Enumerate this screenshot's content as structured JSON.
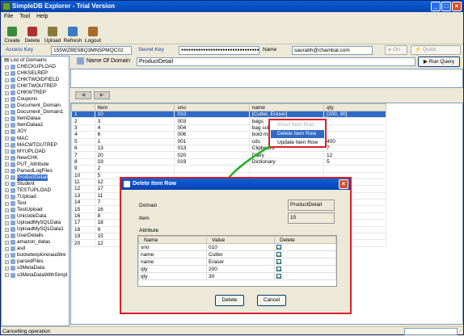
{
  "window": {
    "title": "SimpleDB Explorer - Trial Version"
  },
  "menu": [
    "File",
    "Tool",
    "Help"
  ],
  "toolbar": [
    {
      "label": "Create",
      "icon": "create-icon",
      "color": "#3a8a3a"
    },
    {
      "label": "Delete",
      "icon": "delete-icon",
      "color": "#b03030"
    },
    {
      "label": "Upload",
      "icon": "upload-icon",
      "color": "#8a7a3a"
    },
    {
      "label": "Refresh",
      "icon": "refresh-icon",
      "color": "#3a7ac0"
    },
    {
      "label": "Logout",
      "icon": "logout-icon",
      "color": "#a86a2a"
    }
  ],
  "keys": {
    "access_label": "Access Key",
    "access_value": "155WZBE5BQ3MN5PMQC02",
    "secret_label": "Secret Key",
    "secret_value": "●●●●●●●●●●●●●●●●●●●●●●●●●●●●●●●●●●●●●●●●",
    "name_label": "Name",
    "name_value": "saurabh@chambal.com",
    "go": "Go",
    "quick_connect": "Quick Connect"
  },
  "tree": {
    "root": "List of Domains",
    "items": [
      "CHECKUPLOAD",
      "CHKSELREP",
      "CHKTWOIDFIELD",
      "CHKTWOUTREP",
      "CHKWTREP",
      "Coupons",
      "Document_Domain",
      "Document_Domain1",
      "ItemDataa",
      "ItemDataa1",
      "JOY",
      "MAC",
      "MACWTOUTREP",
      "MYUPLOAD",
      "NewCHK",
      "PUT_Attribute",
      "ParsedLogFiles",
      "ProductDetail",
      "Student",
      "TESTUPLOAD",
      "TUpload",
      "Test",
      "TestUpload",
      "UnicodeData",
      "UploadMySQLData",
      "UploadMySQLData1",
      "UserDetails",
      "amazon_datas",
      "asd",
      "bucketexplorerauditre",
      "parsedFiles",
      "s3MetaData",
      "s3MetaDataWithSimpl"
    ],
    "selected": "ProductDetail"
  },
  "domain": {
    "label": "Name Of Domain",
    "value": "ProductDetail",
    "run_query": "Run Query"
  },
  "grid": {
    "headers": [
      "Item",
      "sno",
      "name",
      "qty"
    ],
    "rows": [
      [
        "1",
        "10",
        "010",
        "[Cutter, Eraser]",
        "[200, 30]"
      ],
      [
        "2",
        "3",
        "003",
        "bags",
        ""
      ],
      [
        "3",
        "4",
        "004",
        "bag school",
        ""
      ],
      [
        "4",
        "6",
        "006",
        "bold marker",
        ""
      ],
      [
        "5",
        "1",
        "001",
        "cds",
        "400"
      ],
      [
        "6",
        "13",
        "013",
        "Clipboard",
        "7"
      ],
      [
        "7",
        "20",
        "020",
        "Diary",
        "12"
      ],
      [
        "8",
        "19",
        "019",
        "Dictionary",
        "5"
      ],
      [
        "9",
        "2",
        "",
        "",
        ""
      ],
      [
        "10",
        "5",
        "",
        "",
        ""
      ],
      [
        "11",
        "12",
        "",
        "",
        ""
      ],
      [
        "12",
        "17",
        "",
        "",
        ""
      ],
      [
        "13",
        "11",
        "",
        "",
        ""
      ],
      [
        "14",
        "7",
        "",
        "",
        ""
      ],
      [
        "15",
        "16",
        "",
        "",
        ""
      ],
      [
        "16",
        "8",
        "",
        "",
        ""
      ],
      [
        "17",
        "18",
        "",
        "",
        ""
      ],
      [
        "18",
        "9",
        "",
        "",
        ""
      ],
      [
        "19",
        "15",
        "",
        "",
        ""
      ],
      [
        "20",
        "12",
        "",
        "",
        ""
      ]
    ]
  },
  "context_menu": {
    "items": [
      "Insert Item Row",
      "Delete Item Row",
      "Update Item Row"
    ],
    "disabled_index": 0,
    "highlight_index": 1
  },
  "dialog": {
    "title": "Delete Item Row",
    "domain_label": "Domain",
    "domain_value": "ProductDetail",
    "item_label": "Item",
    "item_value": "10",
    "attribute_label": "Attribute",
    "headers": [
      "Name",
      "Value",
      "Delete"
    ],
    "rows": [
      [
        "sno",
        "010"
      ],
      [
        "name",
        "Cutter"
      ],
      [
        "name",
        "Eraser"
      ],
      [
        "qty",
        "200"
      ],
      [
        "qty",
        "30"
      ]
    ],
    "delete_btn": "Delete",
    "cancel_btn": "Cancel"
  },
  "status": {
    "text": "Cancelling operation"
  },
  "colors": {
    "accent": "#316ac5",
    "highlight_box": "#d8202a",
    "arrow": "#22b022"
  }
}
